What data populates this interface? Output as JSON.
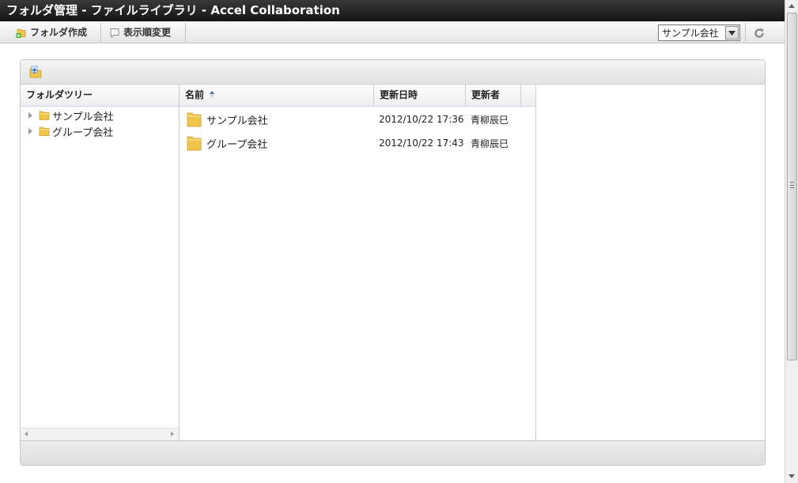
{
  "window": {
    "title": "フォルダ管理 - ファイルライブラリ - Accel Collaboration"
  },
  "toolbar": {
    "create_folder_label": "フォルダ作成",
    "change_order_label": "表示順変更",
    "company_select_value": "サンプル会社"
  },
  "tree": {
    "header": "フォルダツリー",
    "items": [
      {
        "label": "サンプル会社"
      },
      {
        "label": "グループ会社"
      }
    ]
  },
  "list": {
    "columns": {
      "name": "名前",
      "updated_at": "更新日時",
      "updated_by": "更新者"
    },
    "sort_column": "名前",
    "sort_direction": "ascending",
    "rows": [
      {
        "name": "サンプル会社",
        "updated_at": "2012/10/22 17:36",
        "updated_by": "青柳辰巳"
      },
      {
        "name": "グループ会社",
        "updated_at": "2012/10/22 17:43",
        "updated_by": "青柳辰巳"
      }
    ]
  },
  "colors": {
    "titlebar": "#1e1e1e",
    "folder": "#f0c64a",
    "header_border": "#cdd9ea"
  },
  "icons": {
    "create_folder": "folder-add-icon",
    "change_order": "sort-order-icon",
    "refresh": "refresh-icon",
    "upload": "upload-icon",
    "folder": "folder-icon",
    "sort": "sort-ascending-icon"
  }
}
